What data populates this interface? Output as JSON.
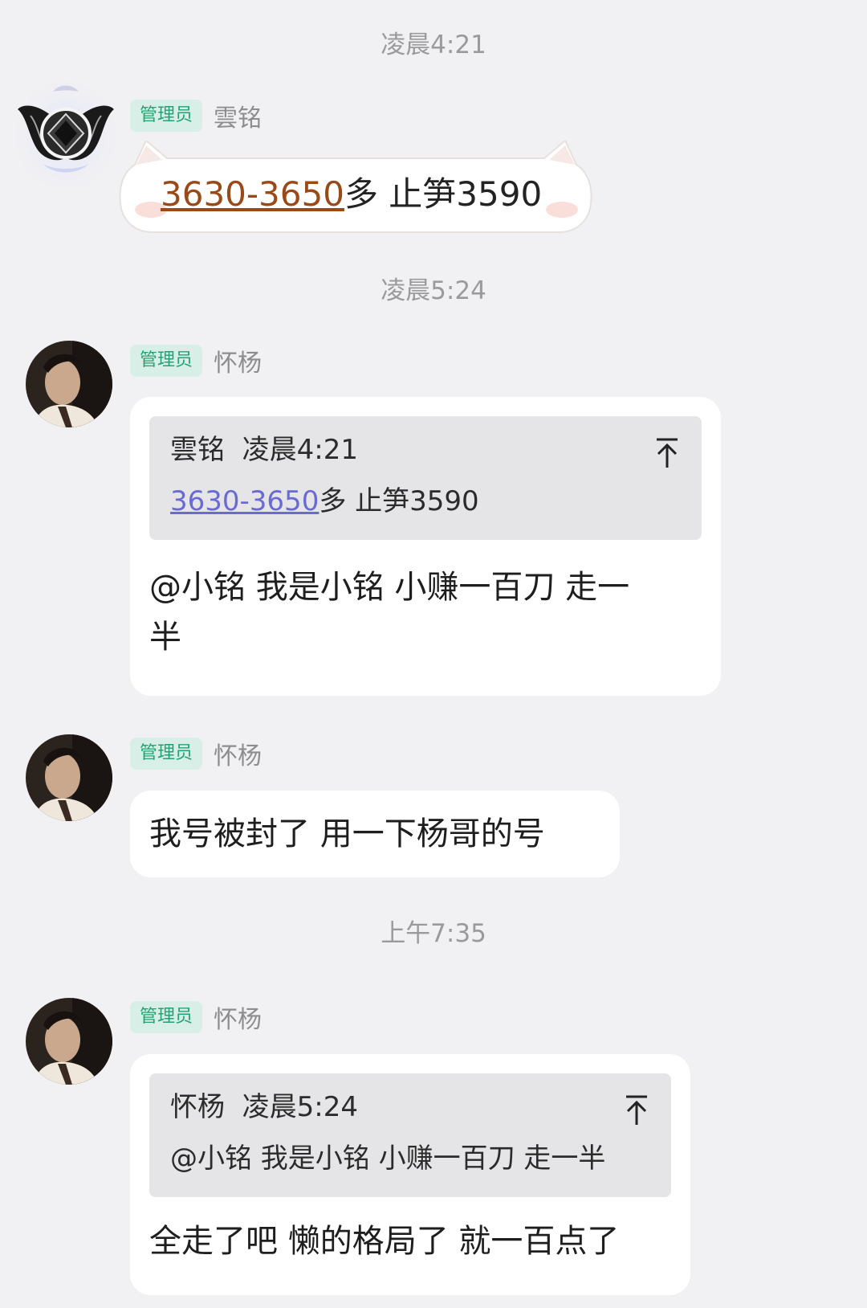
{
  "messages": [
    {
      "time": "凌晨4:21",
      "badge": "管理员",
      "sender": "雲铭",
      "link": "3630-3650",
      "text_after_link": "多  止笋3590"
    },
    {
      "time": "凌晨5:24",
      "badge": "管理员",
      "sender": "怀杨",
      "quote": {
        "author": "雲铭",
        "time": "凌晨4:21",
        "link": "3630-3650",
        "text_after_link": "多  止笋3590"
      },
      "text_line1": "@小铭 我是小铭 小赚一百刀 走一",
      "text_line2": "半"
    },
    {
      "badge": "管理员",
      "sender": "怀杨",
      "text": "我号被封了 用一下杨哥的号"
    },
    {
      "time": "上午7:35",
      "badge": "管理员",
      "sender": "怀杨",
      "quote": {
        "author": "怀杨",
        "time": "凌晨5:24",
        "text": "@小铭 我是小铭 小赚一百刀 走一半"
      },
      "text": "全走了吧 懒的格局了 就一百点了"
    }
  ],
  "icons": {
    "jump_to_quote": "arrow-up-to-line-icon",
    "avatar_1": "winged-emblem-avatar",
    "avatar_2": "portrait-avatar"
  },
  "colors": {
    "background": "#f1f1f3",
    "badge_bg": "#d7efe6",
    "badge_text": "#24a276",
    "link_orange": "#9a4a19",
    "link_blue": "#6a6ad4"
  }
}
